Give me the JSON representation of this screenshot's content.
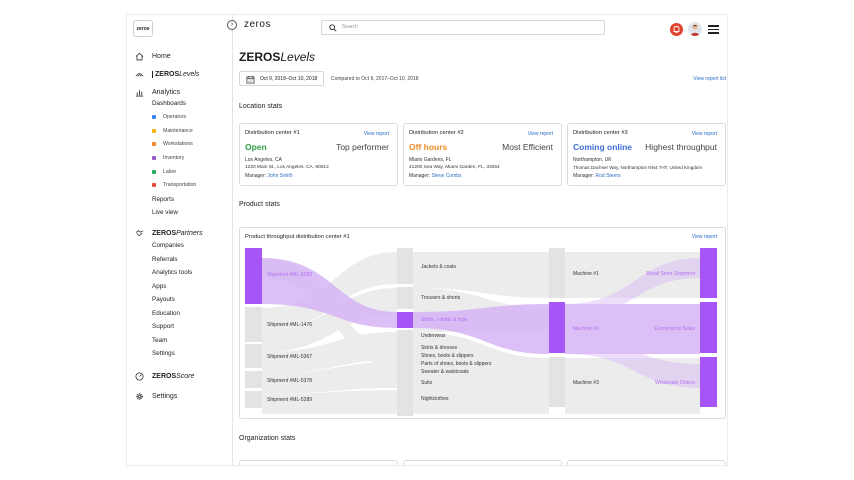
{
  "sidebar": {
    "logo": "zeros",
    "home": "Home",
    "levels_brand": "ZEROS",
    "levels_suffix": "Levels",
    "analytics": "Analytics",
    "dashboards": "Dashboards",
    "dash_items": [
      {
        "label": "Operators",
        "color": "#3b82f6"
      },
      {
        "label": "Maintenance",
        "color": "#f5b301"
      },
      {
        "label": "Workstations",
        "color": "#f08a24"
      },
      {
        "label": "Inventory",
        "color": "#9b59d0"
      },
      {
        "label": "Labor",
        "color": "#27ae60"
      },
      {
        "label": "Transportation",
        "color": "#e74c3c"
      }
    ],
    "reports": "Reports",
    "live_view": "Live view",
    "partners_brand": "ZEROS",
    "partners_suffix": "Partners",
    "partner_items": [
      "Companies",
      "Referrals",
      "Analytics tools",
      "Apps",
      "Payouts",
      "Education",
      "Support",
      "Team",
      "Settings"
    ],
    "score_brand": "ZEROS",
    "score_suffix": "Score",
    "settings": "Settings"
  },
  "topbar": {
    "brand": "zeros",
    "search_placeholder": "Search"
  },
  "page": {
    "title_bold": "ZEROS",
    "title_italic": "Levels",
    "date_range": "Oct 9, 2018–Oct 10, 2018",
    "compare": "Compared to Oct 9, 2017–Oct 10, 2018",
    "view_report_list": "View report list",
    "location_stats": "Location stats",
    "product_stats": "Product stats",
    "organization_stats": "Organization stats"
  },
  "locations": [
    {
      "title": "Distribution center #1",
      "view": "View report",
      "status": "Open",
      "status_color": "#2e9e44",
      "tag": "Top performer",
      "city": "Los Angeles, CA",
      "address": "1220 Main St., Los Angeles, CA, 90012",
      "manager_label": "Manager:",
      "manager": "John Smith"
    },
    {
      "title": "Distribution center #2",
      "view": "View report",
      "status": "Off hours",
      "status_color": "#f08a24",
      "tag": "Most Efficient",
      "city": "Miami Gardens, FL",
      "address": "41200 Sea Way, Miami Garden, FL, 33054",
      "manager_label": "Manager:",
      "manager": "Steve Combs"
    },
    {
      "title": "Distribution center #3",
      "view": "View report",
      "status": "Coming online",
      "status_color": "#3a6fd8",
      "tag": "Highest throughput",
      "city": "Northampton, UK",
      "address": "Thomas Dachser Way, Northampton NN4 7HT, United Kingdom",
      "manager_label": "Manager:",
      "manager": "Rod Steers"
    }
  ],
  "product": {
    "title": "Product throughput distribution center #1",
    "view": "View report",
    "shipments": [
      "Shipment #ML-5289",
      "Shipment #ML-1476",
      "Shipment #ML-5367",
      "Shipment #ML-5378",
      "Shipment #ML-5289"
    ],
    "categories": [
      "Jackets & coats",
      "Trousers & shorts",
      "Shirts, t-shirts & tops",
      "Underwear",
      "Skirts & dresses",
      "Shoes, boots & slippers",
      "Parts of shoes, boots & slippers",
      "Sweater & waistcoats",
      "Suits",
      "Nightclothes"
    ],
    "machines": [
      "Machine #1",
      "Machine #2",
      "Machine #3"
    ],
    "destinations": [
      "Retail Store Shipment",
      "Ecommerce Sales",
      "Wholesale Orders"
    ],
    "accent": "#a855f7"
  }
}
